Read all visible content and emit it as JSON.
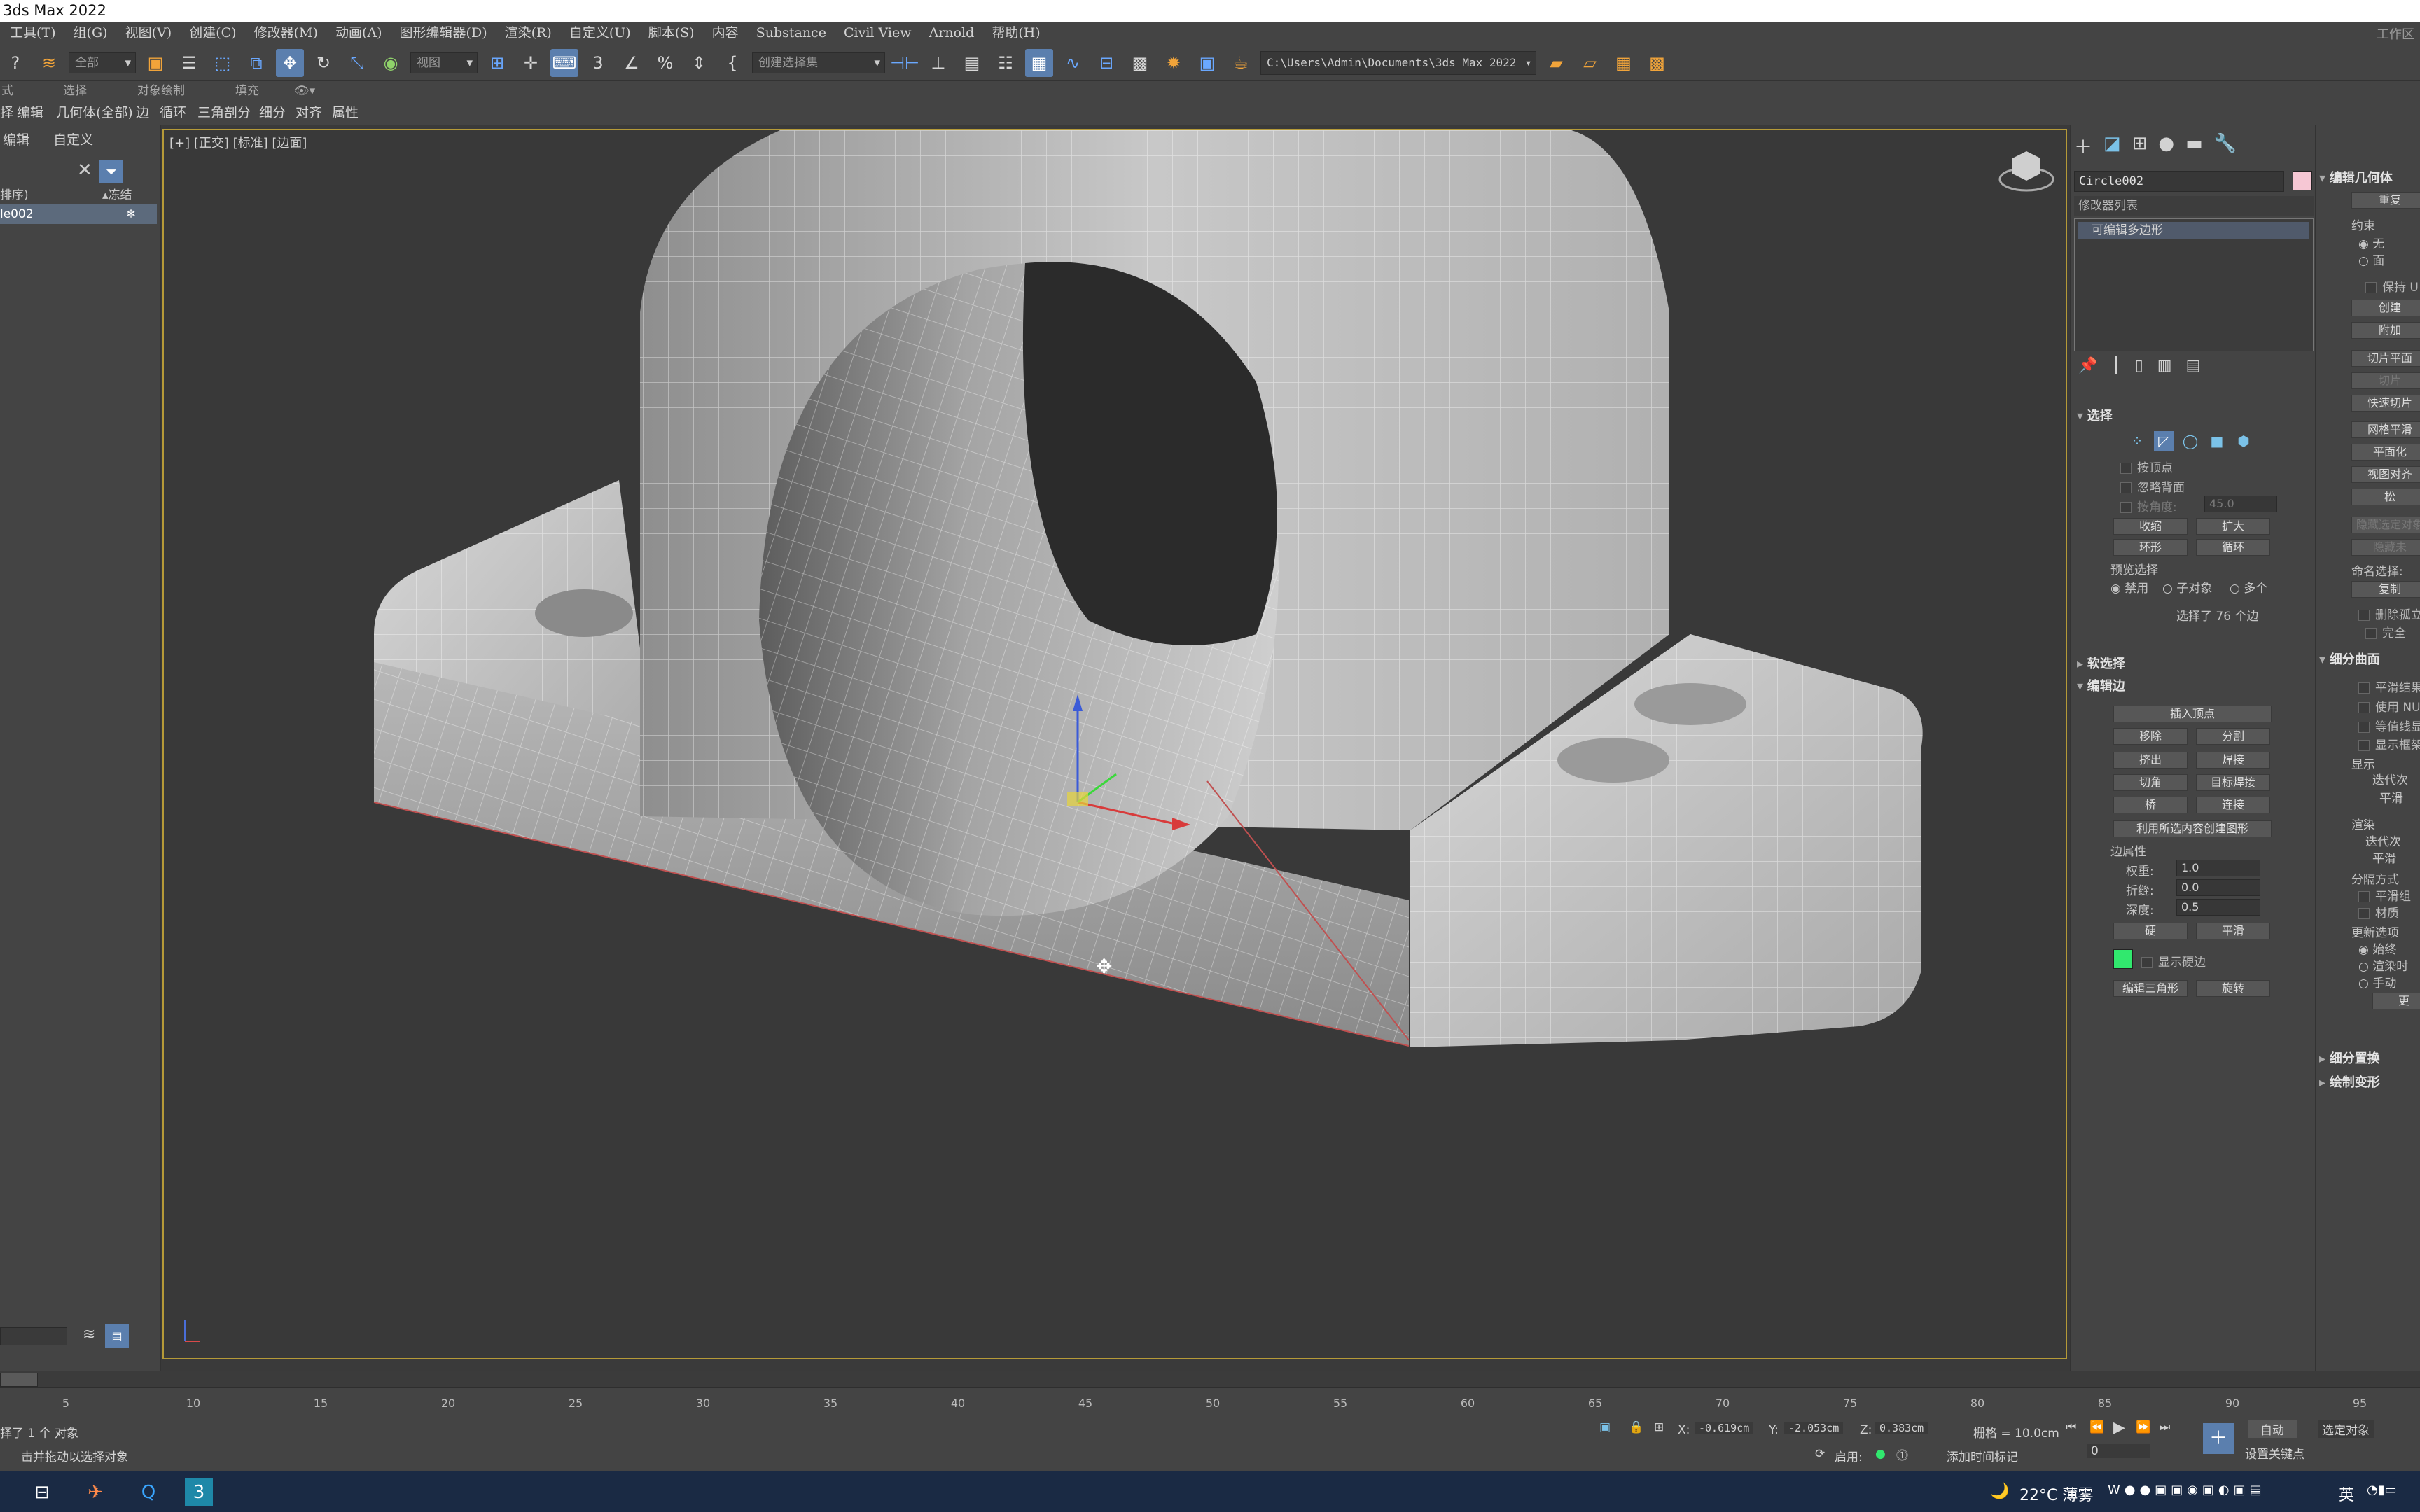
{
  "window": {
    "title": "3ds Max 2022",
    "workspace": "工作区"
  },
  "menu": [
    "工具(T)",
    "组(G)",
    "视图(V)",
    "创建(C)",
    "修改器(M)",
    "动画(A)",
    "图形编辑器(D)",
    "渲染(R)",
    "自定义(U)",
    "脚本(S)",
    "内容",
    "Substance",
    "Civil View",
    "Arnold",
    "帮助(H)"
  ],
  "toolbar": {
    "selection_filter": "全部",
    "ref_coord": "视图",
    "named_selection": "创建选择集",
    "project_path": "C:\\Users\\Admin\\Documents\\3ds Max 2022"
  },
  "ribbon": {
    "tab_modeling": "式",
    "tab_selection": "选择",
    "tab_object_paint": "对象绘制",
    "tab_populate": "填充"
  },
  "subribbon": [
    "择",
    "编辑",
    "几何体(全部)",
    "边",
    "循环",
    "三角剖分",
    "细分",
    "对齐",
    "属性"
  ],
  "scene_explorer": {
    "tabs": [
      "编辑",
      "自定义"
    ],
    "col_sort": "排序)",
    "col_freeze": "▴冻结",
    "selected_object": "le002"
  },
  "viewport": {
    "label": "[+] [正交] [标准] [边面]"
  },
  "command_panel": {
    "object_name": "Circle002",
    "modifier_list": "修改器列表",
    "stack_item": "可编辑多边形",
    "selection": {
      "title": "选择",
      "by_vertex": "按顶点",
      "ignore_backfacing": "忽略背面",
      "by_angle": "按角度:",
      "angle_value": "45.0",
      "shrink": "收缩",
      "grow": "扩大",
      "ring": "环形",
      "loop": "循环",
      "preview_selection": "预览选择",
      "preview_off": "禁用",
      "preview_subobj": "子对象",
      "preview_multi": "多个",
      "status": "选择了 76 个边"
    },
    "soft_selection": "软选择",
    "edit_edges": {
      "title": "编辑边",
      "insert_vertex": "插入顶点",
      "remove": "移除",
      "split": "分割",
      "extrude": "挤出",
      "weld": "焊接",
      "chamfer": "切角",
      "target_weld": "目标焊接",
      "bridge": "桥",
      "connect": "连接",
      "create_shape": "利用所选内容创建图形",
      "edge_props": "边属性",
      "weight_label": "权重:",
      "weight_value": "1.0",
      "crease_label": "折缝:",
      "crease_value": "0.0",
      "depth_label": "深度:",
      "depth_value": "0.5",
      "hard": "硬",
      "smooth": "平滑",
      "show_hard_edges": "显示硬边",
      "edit_tri": "编辑三角形",
      "turn": "旋转"
    }
  },
  "command_panel2": {
    "edit_geometry": "编辑几何体",
    "repeat_last": "重复",
    "constraints": "约束",
    "none": "无",
    "face": "面",
    "preserve_uvs": "保持 U",
    "create": "创建",
    "attach": "附加",
    "slice_plane": "切片平面",
    "slice": "切片",
    "quickslice": "快速切片",
    "meshsmooth": "网格平滑",
    "planarize": "平面化",
    "view_align": "视图对齐",
    "relax": "松",
    "hide_selected": "隐藏选定对象",
    "hide_unselected": "隐藏未",
    "named_sel": "命名选择:",
    "copy": "复制",
    "delete_isolated": "删除孤立",
    "full_interop": "完全",
    "subdivision_surface": "细分曲面",
    "smooth_result": "平滑结果",
    "use_nurms": "使用 NU",
    "isoline": "等值线显",
    "show_cage": "显示框架",
    "display": "显示",
    "iterations": "迭代次",
    "smoothness": "平滑",
    "render": "渲染",
    "iterations2": "迭代次",
    "smoothness2": "平滑",
    "separate_by": "分隔方式",
    "smoothing_groups": "平滑组",
    "materials": "材质",
    "update_options": "更新选项",
    "always": "始终",
    "when_rendering": "渲染时",
    "manually": "手动",
    "update": "更",
    "subdivision_displacement": "细分置换",
    "paint_deformation": "绘制变形"
  },
  "timeline": {
    "ticks": [
      "5",
      "10",
      "15",
      "20",
      "25",
      "30",
      "35",
      "40",
      "45",
      "50",
      "55",
      "60",
      "65",
      "70",
      "75",
      "80",
      "85",
      "90",
      "95"
    ]
  },
  "status": {
    "selected": "择了 1 个 对象",
    "prompt": "击并拖动以选择对象",
    "x_label": "X:",
    "x": "-0.619cm",
    "y_label": "Y:",
    "y": "-2.053cm",
    "z_label": "Z:",
    "z": "0.383cm",
    "grid": "栅格 = 10.0cm",
    "enabled": "启用:",
    "add_time_tag": "添加时间标记",
    "auto_key": "自动",
    "selected_objects": "选定对象",
    "set_key": "设置关键点",
    "frame": "0"
  },
  "taskbar": {
    "weather": "22°C 薄雾",
    "ime": "英"
  }
}
